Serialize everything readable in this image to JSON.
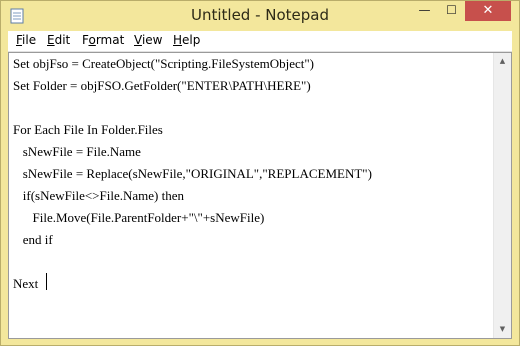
{
  "window": {
    "title": "Untitled - Notepad",
    "controls": {
      "minimize": "—",
      "maximize": "☐",
      "close": "✕"
    }
  },
  "menu": [
    {
      "label": "File",
      "key": "F",
      "rest": "ile"
    },
    {
      "label": "Edit",
      "key": "E",
      "rest": "dit"
    },
    {
      "label": "Format",
      "key": "o",
      "pre": "F",
      "rest": "rmat"
    },
    {
      "label": "View",
      "key": "V",
      "rest": "iew"
    },
    {
      "label": "Help",
      "key": "H",
      "rest": "elp"
    }
  ],
  "editor": {
    "lines": [
      "Set objFso = CreateObject(\"Scripting.FileSystemObject\")",
      "Set Folder = objFSO.GetFolder(\"ENTER\\PATH\\HERE\")",
      "",
      "For Each File In Folder.Files",
      "   sNewFile = File.Name",
      "   sNewFile = Replace(sNewFile,\"ORIGINAL\",\"REPLACEMENT\")",
      "   if(sNewFile<>File.Name) then",
      "      File.Move(File.ParentFolder+\"\\\"+sNewFile)",
      "   end if",
      "",
      "Next"
    ]
  },
  "icons": {
    "app": "notepad-icon",
    "scroll_up": "scroll-up-arrow-icon",
    "scroll_down": "scroll-down-arrow-icon"
  }
}
